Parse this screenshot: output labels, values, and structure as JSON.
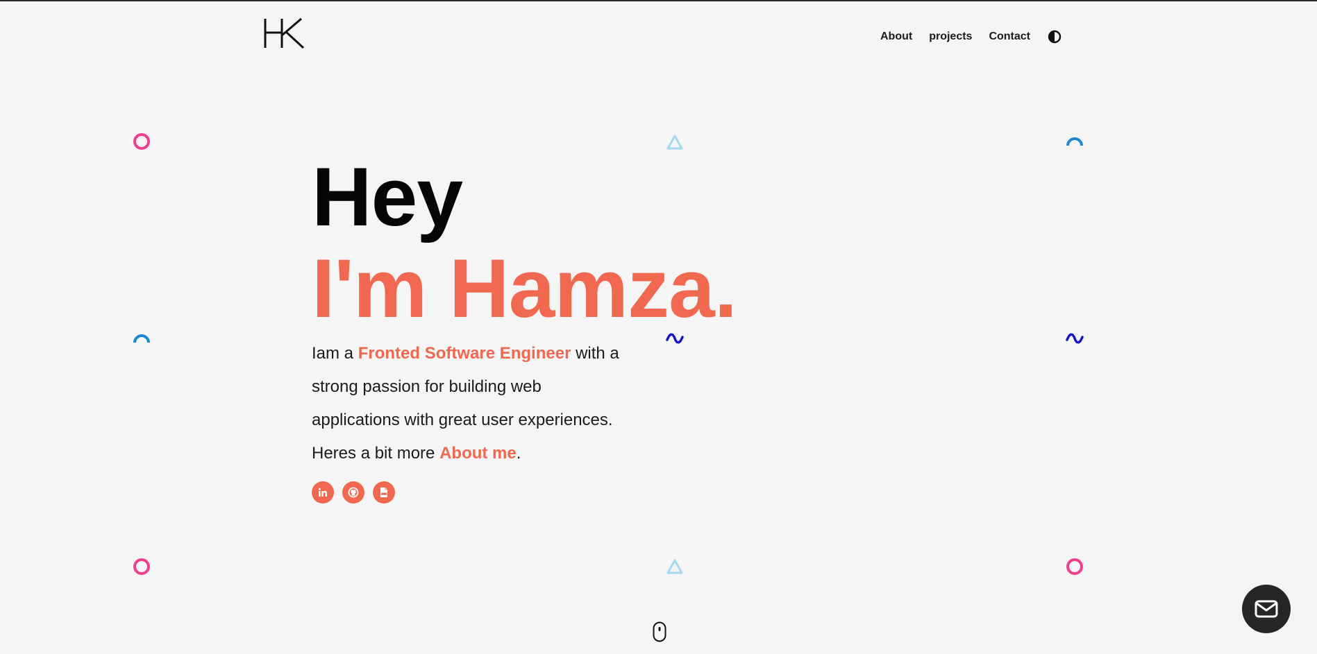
{
  "header": {
    "logo_text": "HK",
    "nav": [
      {
        "label": "About"
      },
      {
        "label": "projects"
      },
      {
        "label": "Contact"
      }
    ],
    "theme_toggle_icon": "contrast-icon"
  },
  "hero": {
    "greeting": "Hey",
    "name_line": "I'm Hamza.",
    "intro": {
      "part1": "Iam a ",
      "role": "Fronted Software Engineer",
      "part2": " with a strong passion for building web applications with great user experiences. Heres a bit more ",
      "about_link": "About me",
      "part3": "."
    },
    "socials": [
      {
        "icon": "linkedin-icon"
      },
      {
        "icon": "github-icon"
      },
      {
        "icon": "pdf-icon"
      }
    ]
  },
  "decorations": {
    "colors": {
      "circle": "#ef3f8f",
      "arc": "#1e88d1",
      "triangle": "#a6d8f2",
      "wave": "#1212c8"
    }
  },
  "colors": {
    "accent": "#f0684f",
    "background": "#f5f5f5",
    "text": "#1b1b1b",
    "fab": "#262626"
  },
  "fab": {
    "icon": "mail-icon"
  },
  "scroll": {
    "icon": "mouse-scroll-icon"
  }
}
